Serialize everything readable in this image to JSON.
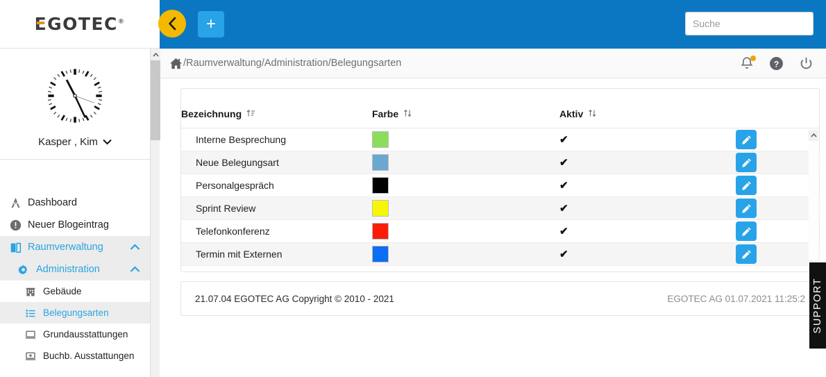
{
  "brand": {
    "logo_text": "EGOTEC",
    "registered_mark": "®",
    "accent_color": "#e8921e"
  },
  "topbar": {
    "background_color": "#0b77c2",
    "back_button_label": "‹",
    "add_button_label": "+",
    "search_placeholder": "Suche",
    "search_value": ""
  },
  "breadcrumb": {
    "home_icon": "home-icon",
    "path": "/Raumverwaltung/Administration/Belegungsarten",
    "icons": [
      "notification-bell-icon",
      "help-icon",
      "power-icon"
    ]
  },
  "sidebar": {
    "user": {
      "name": "Kasper , Kim",
      "caret": "⌄",
      "clock_time": "11:25"
    },
    "items": [
      {
        "label": "Dashboard",
        "icon": "dashboard-icon",
        "level": 0,
        "active": false,
        "expanded": null
      },
      {
        "label": "Neuer Blogeintrag",
        "icon": "info-icon",
        "level": 0,
        "active": false,
        "expanded": null
      },
      {
        "label": "Raumverwaltung",
        "icon": "door-icon",
        "level": 1,
        "active": false,
        "expanded": true
      },
      {
        "label": "Administration",
        "icon": "gear-icon",
        "level": 2,
        "active": false,
        "expanded": true
      },
      {
        "label": "Gebäude",
        "icon": "building-icon",
        "level": 3,
        "active": false,
        "expanded": null
      },
      {
        "label": "Belegungsarten",
        "icon": "list-icon",
        "level": 3,
        "active": true,
        "expanded": null
      },
      {
        "label": "Grundausstattungen",
        "icon": "monitor-icon",
        "level": 3,
        "active": false,
        "expanded": null
      },
      {
        "label": "Buchb. Ausstattungen",
        "icon": "monitor-plus-icon",
        "level": 3,
        "active": false,
        "expanded": null
      }
    ]
  },
  "table": {
    "columns": [
      {
        "label": "Bezeichnung",
        "sort_icon": "sort-asc-icon"
      },
      {
        "label": "Farbe",
        "sort_icon": "sort-both-icon"
      },
      {
        "label": "Aktiv",
        "sort_icon": "sort-both-icon"
      }
    ],
    "rows": [
      {
        "name": "Interne Besprechung",
        "color": "#8ade5a",
        "aktiv": "✔",
        "action": "edit-icon"
      },
      {
        "name": "Neue Belegungsart",
        "color": "#6ba8cf",
        "aktiv": "✔",
        "action": "edit-icon"
      },
      {
        "name": "Personalgespräch",
        "color": "#000000",
        "aktiv": "✔",
        "action": "edit-icon"
      },
      {
        "name": "Sprint Review",
        "color": "#f7f700",
        "aktiv": "✔",
        "action": "edit-icon"
      },
      {
        "name": "Telefonkonferenz",
        "color": "#fa1e0a",
        "aktiv": "✔",
        "action": "edit-icon"
      },
      {
        "name": "Termin mit Externen",
        "color": "#0b6ef5",
        "aktiv": "✔",
        "action": "edit-icon"
      }
    ]
  },
  "footer": {
    "left": "21.07.04 EGOTEC AG Copyright © 2010 - 2021",
    "right": "EGOTEC AG  01.07.2021 11:25:2"
  },
  "support": {
    "label": "SUPPORT"
  }
}
